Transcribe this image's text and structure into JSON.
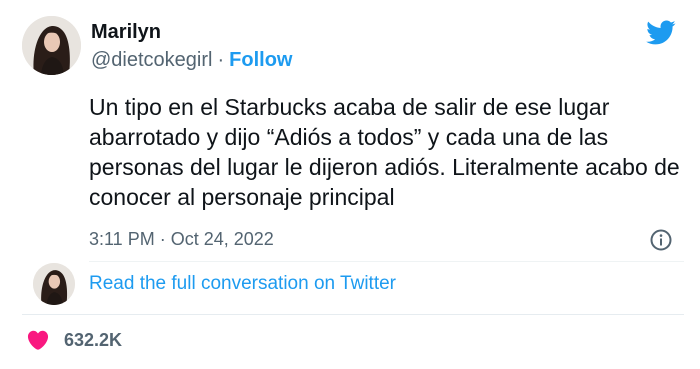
{
  "author": {
    "name": "Marilyn",
    "handle": "@dietcokegirl",
    "separator": "·",
    "follow_label": "Follow"
  },
  "tweet": {
    "text": "Un tipo en el Starbucks acaba de salir de ese lugar abarrotado y dijo “Adiós a todos” y cada una de las personas del lugar le dijeron adiós. Literalmente acabo de conocer al personaje principal",
    "timestamp": "3:11 PM · Oct 24, 2022"
  },
  "conversation": {
    "link_label": "Read the full conversation on Twitter"
  },
  "engagement": {
    "likes": "632.2K"
  },
  "icons": {
    "brand": "twitter-bird-icon",
    "info": "info-icon",
    "like": "heart-icon"
  },
  "colors": {
    "accent": "#1d9bf0",
    "heart": "#f91880",
    "secondary_text": "#536471"
  }
}
